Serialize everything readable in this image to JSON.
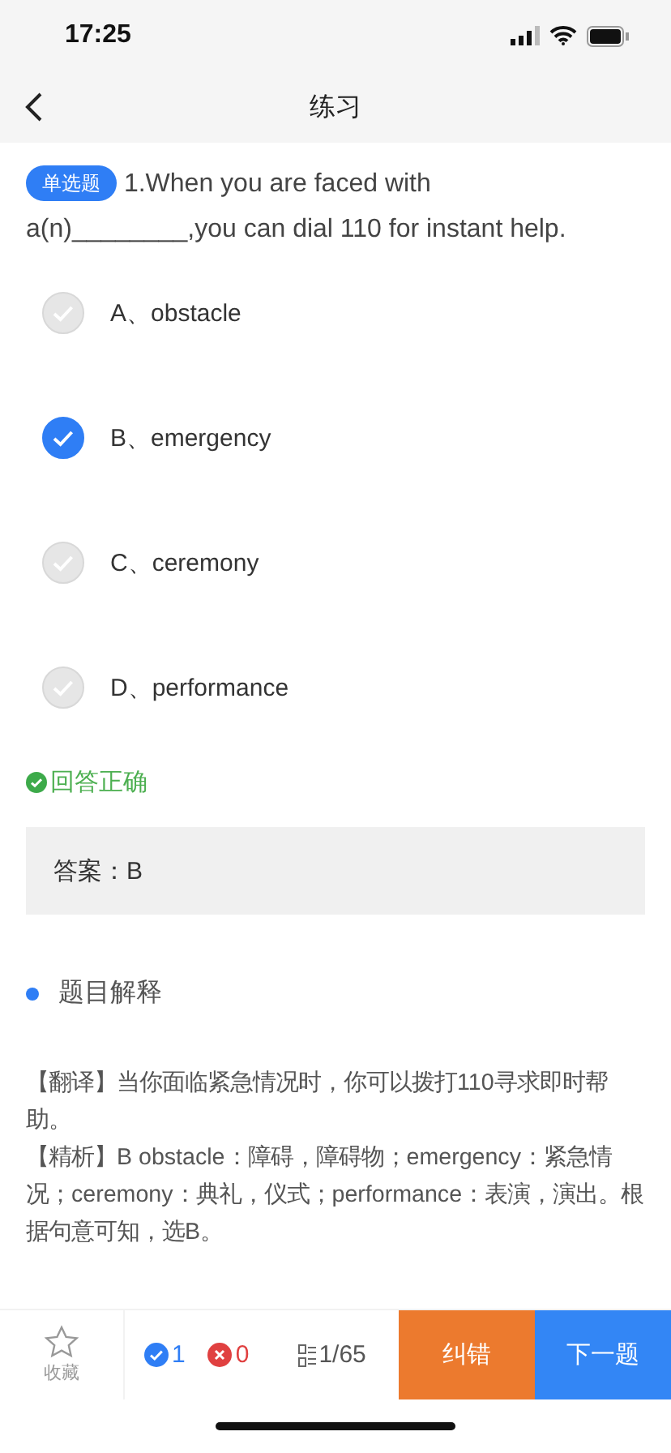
{
  "status_bar": {
    "time": "17:25"
  },
  "nav": {
    "title": "练习"
  },
  "question": {
    "type_badge": "单选题",
    "text": "1.When you are faced with a(n)________,you can dial 110 for instant help."
  },
  "options": [
    {
      "label": "A、obstacle",
      "selected": false
    },
    {
      "label": "B、emergency",
      "selected": true
    },
    {
      "label": "C、ceremony",
      "selected": false
    },
    {
      "label": "D、performance",
      "selected": false
    }
  ],
  "result": {
    "correct": true,
    "text": "回答正确"
  },
  "answer": "答案：B",
  "section_title": "题目解释",
  "explanation": [
    "【翻译】当你面临紧急情况时，你可以拨打110寻求即时帮助。",
    "【精析】B obstacle：障碍，障碍物；emergency：紧急情况；ceremony：典礼，仪式；performance：表演，演出。根据句意可知，选B。"
  ],
  "bottom_bar": {
    "favorite": "收藏",
    "right_count": "1",
    "wrong_count": "0",
    "progress": "1/65",
    "report_button": "纠错",
    "next_button": "下一题"
  }
}
